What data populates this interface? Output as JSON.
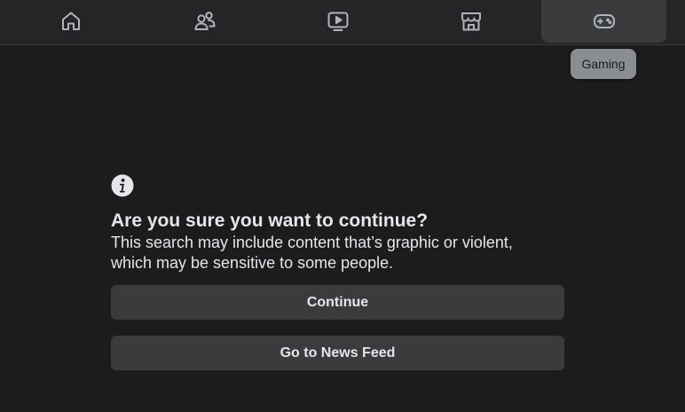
{
  "nav": {
    "tabs": [
      {
        "icon": "home-icon",
        "active": false
      },
      {
        "icon": "friends-icon",
        "active": false
      },
      {
        "icon": "watch-icon",
        "active": false
      },
      {
        "icon": "marketplace-icon",
        "active": false
      },
      {
        "icon": "gaming-icon",
        "active": true
      }
    ],
    "tooltip": "Gaming"
  },
  "dialog": {
    "icon": "info-icon",
    "title": "Are you sure you want to continue?",
    "body_line1": "This search may include content that’s graphic or violent,",
    "body_line2": "which may be sensitive to some people.",
    "continue_label": "Continue",
    "feed_label": "Go to News Feed"
  },
  "colors": {
    "background": "#1c1c1d",
    "nav_background": "#242526",
    "button_background": "#3a3b3c",
    "text": "#e4e6eb",
    "tooltip_background": "#8a8d91"
  }
}
